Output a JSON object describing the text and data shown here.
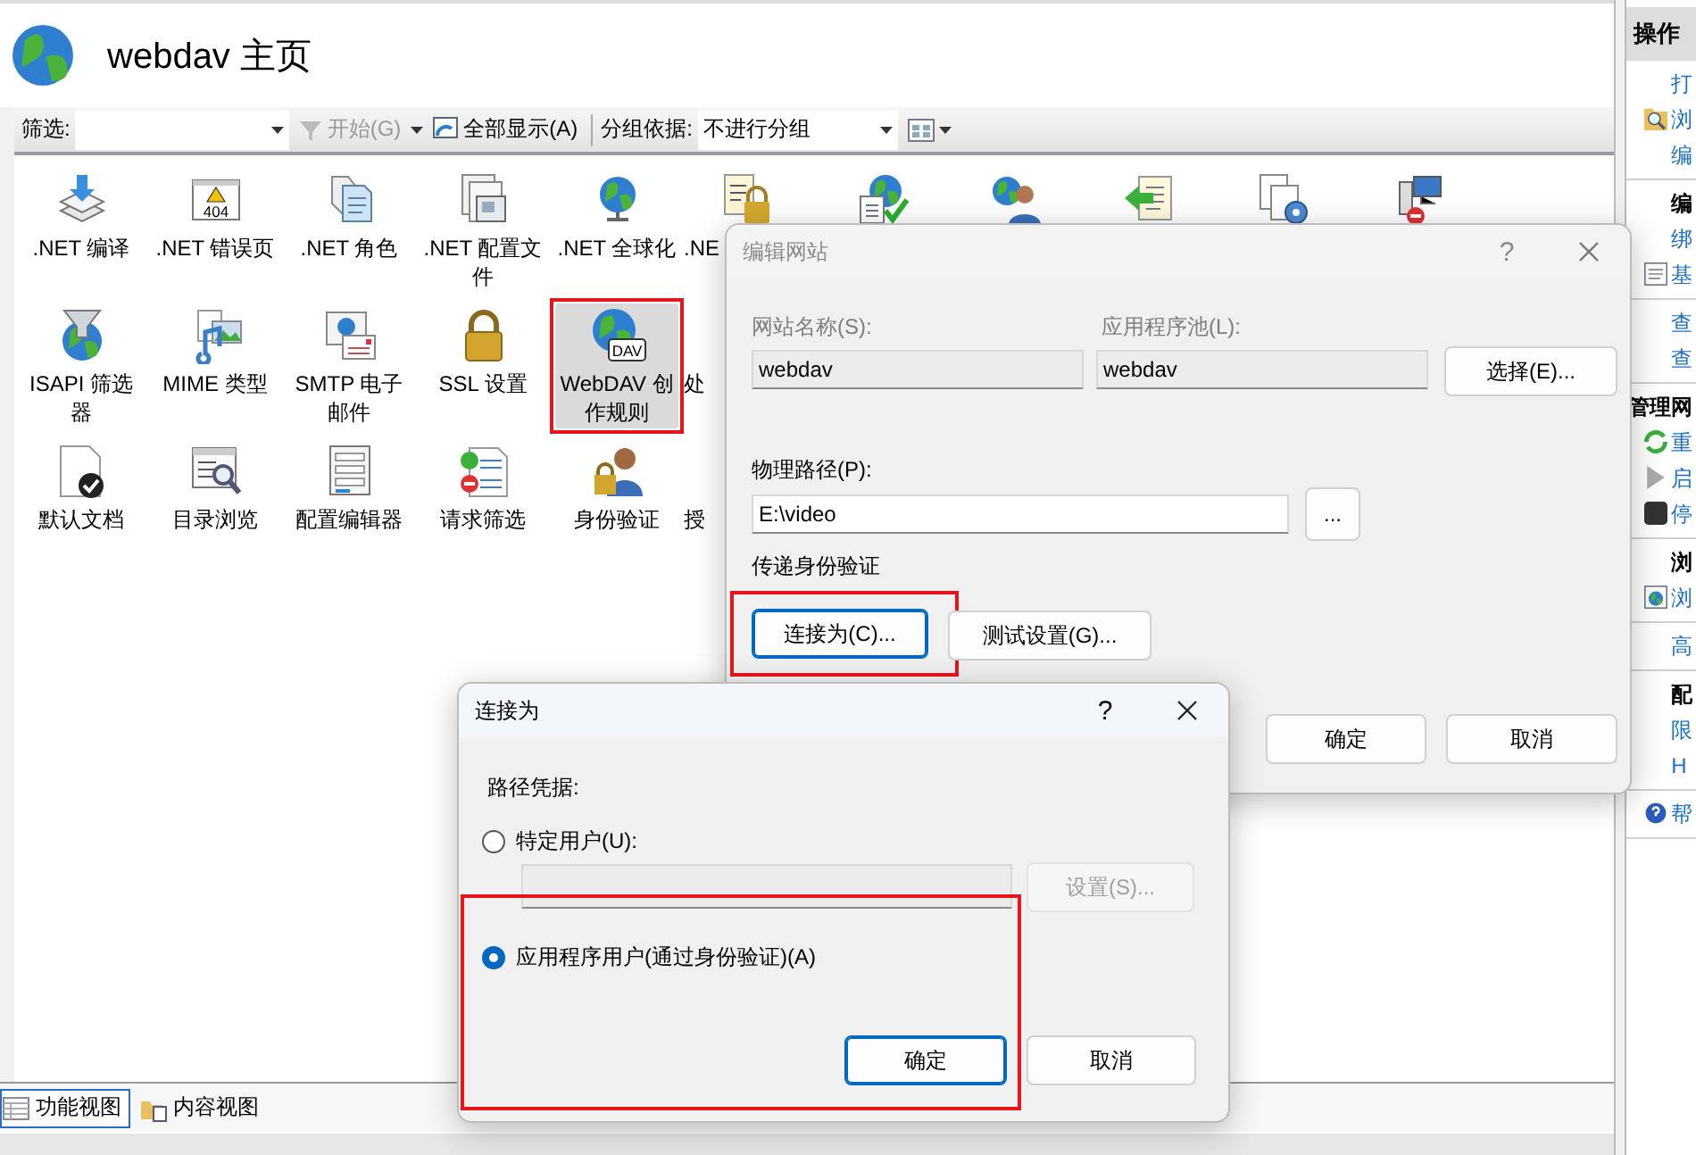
{
  "main": {
    "title": "webdav 主页"
  },
  "toolbar": {
    "filter_label": "筛选:",
    "start_button": {
      "label": "开始(G)",
      "disabled": true
    },
    "show_all_button": {
      "label": "全部显示(A)",
      "disabled": false
    },
    "group_label": "分组依据:",
    "group_value": "不进行分组"
  },
  "features": [
    [
      {
        "label": ".NET 编译",
        "selected": false,
        "highlighted": false
      },
      {
        "label": ".NET 错误页",
        "icon_text": "404",
        "selected": false,
        "highlighted": false
      },
      {
        "label": ".NET 角色",
        "selected": false,
        "highlighted": false
      },
      {
        "label": ".NET 配置文件",
        "selected": false,
        "highlighted": false
      },
      {
        "label": ".NET 全球化",
        "selected": false,
        "highlighted": false
      },
      {
        "label": ".NE",
        "selected": false,
        "highlighted": false
      },
      {
        "selected": false,
        "highlighted": false
      },
      {
        "selected": false,
        "highlighted": false
      },
      {
        "selected": false,
        "highlighted": false
      },
      {
        "selected": false,
        "highlighted": false
      },
      {
        "selected": false,
        "highlighted": false
      }
    ],
    [
      {
        "label": "ISAPI 筛选器",
        "selected": false,
        "highlighted": false
      },
      {
        "label": "MIME 类型",
        "selected": false,
        "highlighted": false
      },
      {
        "label": "SMTP 电子邮件",
        "selected": false,
        "highlighted": false
      },
      {
        "label": "SSL 设置",
        "selected": false,
        "highlighted": false
      },
      {
        "label": "WebDAV 创作规则",
        "icon_text": "DAV",
        "selected": true,
        "highlighted": true
      },
      {
        "label": "处",
        "selected": false,
        "highlighted": false
      }
    ],
    [
      {
        "label": "默认文档",
        "selected": false,
        "highlighted": false
      },
      {
        "label": "目录浏览",
        "selected": false,
        "highlighted": false
      },
      {
        "label": "配置编辑器",
        "selected": false,
        "highlighted": false
      },
      {
        "label": "请求筛选",
        "selected": false,
        "highlighted": false
      },
      {
        "label": "身份验证",
        "selected": false,
        "highlighted": false
      },
      {
        "label": "授",
        "selected": false,
        "highlighted": false
      }
    ]
  ],
  "view_tabs": [
    {
      "label": "功能视图",
      "selected": true
    },
    {
      "label": "内容视图",
      "selected": false
    }
  ],
  "actions": {
    "title": "操作",
    "groups": [
      [
        {
          "kind": "link",
          "text": "打"
        },
        {
          "kind": "link",
          "text": "浏"
        },
        {
          "kind": "link",
          "text": "编"
        }
      ],
      [
        {
          "kind": "header",
          "text": "编"
        },
        {
          "kind": "link",
          "text": "绑"
        },
        {
          "kind": "link",
          "text": "基"
        }
      ],
      [
        {
          "kind": "link",
          "text": "查"
        },
        {
          "kind": "link",
          "text": "查"
        }
      ],
      [
        {
          "kind": "group",
          "text": "管理网"
        },
        {
          "kind": "link",
          "text": "重"
        },
        {
          "kind": "link",
          "text": "启"
        },
        {
          "kind": "link",
          "text": "停"
        }
      ],
      [
        {
          "kind": "header",
          "text": "浏"
        },
        {
          "kind": "link",
          "text": "浏"
        }
      ],
      [
        {
          "kind": "link",
          "text": "高"
        }
      ],
      [
        {
          "kind": "header",
          "text": "配"
        },
        {
          "kind": "link",
          "text": "限"
        },
        {
          "kind": "link",
          "text": "H"
        }
      ],
      [
        {
          "kind": "link",
          "text": "帮"
        }
      ]
    ]
  },
  "edit_site_dialog": {
    "title": "编辑网站",
    "help": "?",
    "active": false,
    "site_name": {
      "label": "网站名称(S):",
      "value": "webdav",
      "disabled": true
    },
    "app_pool": {
      "label": "应用程序池(L):",
      "value": "webdav",
      "disabled": true
    },
    "select_button": {
      "label": "选择(E)...",
      "focused": false
    },
    "physical_path": {
      "label": "物理路径(P):",
      "value": "E:\\video",
      "disabled": false
    },
    "browse_button": {
      "label": "...",
      "focused": false
    },
    "pass_through_label": "传递身份验证",
    "connect_as_button": {
      "label": "连接为(C)...",
      "focused": true,
      "highlighted": true
    },
    "test_button": {
      "label": "测试设置(G)...",
      "focused": false
    },
    "ok_button": {
      "label": "确定",
      "focused": false
    },
    "cancel_button": {
      "label": "取消",
      "focused": false
    }
  },
  "connect_as_dialog": {
    "title": "连接为",
    "help": "?",
    "active": true,
    "credentials_label": "路径凭据:",
    "options": [
      {
        "label": "特定用户(U):",
        "selected": false
      },
      {
        "label": "应用程序用户(通过身份验证)(A)",
        "selected": true
      }
    ],
    "user_field": {
      "disabled": true
    },
    "set_button": {
      "label": "设置(S)...",
      "disabled": true
    },
    "ok_button": {
      "label": "确定",
      "focused": true
    },
    "cancel_button": {
      "label": "取消",
      "focused": false
    },
    "highlighted_area": true
  }
}
